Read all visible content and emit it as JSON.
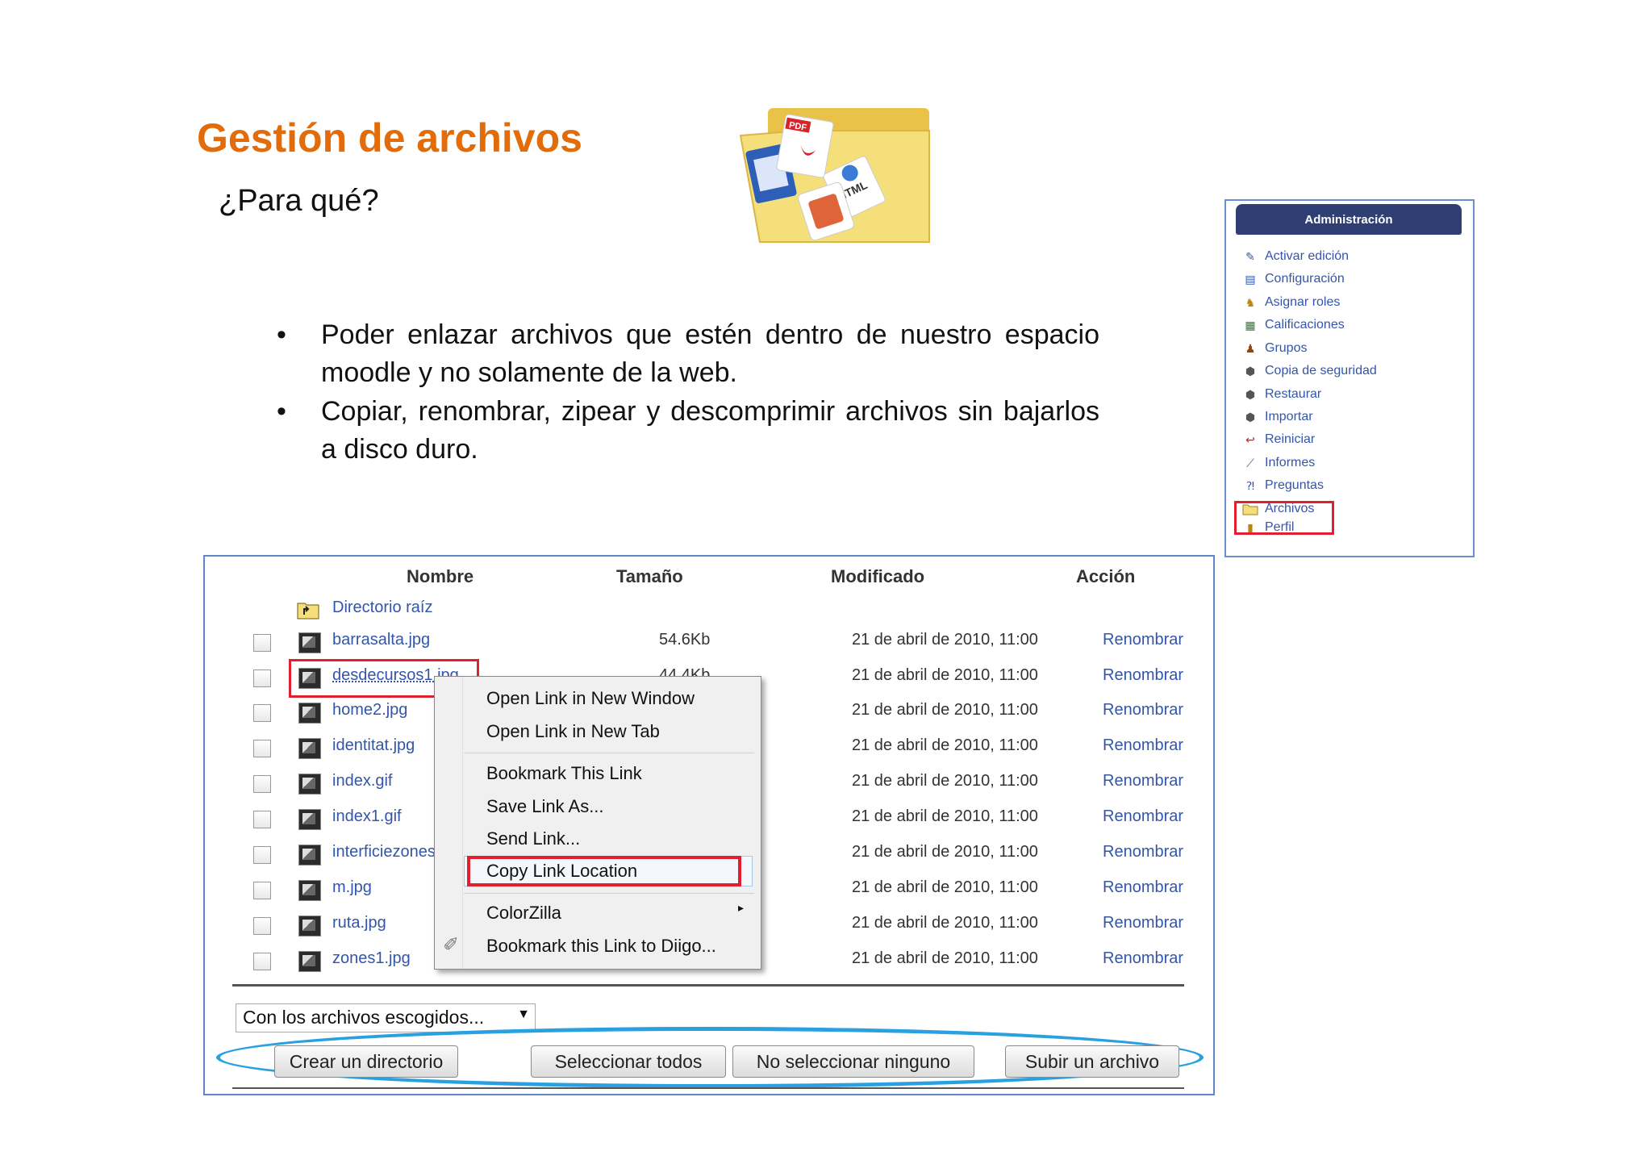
{
  "slide": {
    "title": "Gestión de archivos",
    "subtitle": "¿Para qué?",
    "bullets": [
      {
        "marker": "•",
        "text": "Poder enlazar archivos que estén dentro de nuestro espacio moodle y no solamente de la web."
      },
      {
        "marker": "•",
        "text": "Copiar, renombrar, zipear y descomprimir archivos sin bajarlos a disco duro."
      }
    ]
  },
  "folder_graphic": {
    "labels": [
      "PDF",
      "HTML"
    ]
  },
  "admin": {
    "header": "Administración",
    "items": [
      {
        "label": "Activar edición",
        "icon": "pencil-icon"
      },
      {
        "label": "Configuración",
        "icon": "settings-icon"
      },
      {
        "label": "Asignar roles",
        "icon": "roles-icon"
      },
      {
        "label": "Calificaciones",
        "icon": "grades-icon"
      },
      {
        "label": "Grupos",
        "icon": "groups-icon"
      },
      {
        "label": "Copia de seguridad",
        "icon": "backup-icon"
      },
      {
        "label": "Restaurar",
        "icon": "restore-icon"
      },
      {
        "label": "Importar",
        "icon": "import-icon"
      },
      {
        "label": "Reiniciar",
        "icon": "reset-icon"
      },
      {
        "label": "Informes",
        "icon": "reports-icon"
      },
      {
        "label": "Preguntas",
        "icon": "questions-icon"
      },
      {
        "label": "Archivos",
        "icon": "folder-icon"
      },
      {
        "label": "Perfil",
        "icon": "profile-icon"
      }
    ]
  },
  "files": {
    "columns": [
      "Nombre",
      "Tamaño",
      "Modificado",
      "Acción"
    ],
    "root_dir": "Directorio raíz",
    "rows": [
      {
        "name": "barrasalta.jpg",
        "size": "54.6Kb",
        "modified": "21 de abril de 2010, 11:00",
        "action": "Renombrar"
      },
      {
        "name": "desdecursos1.jpg",
        "size": "44.4Kb",
        "modified": "21 de abril de 2010, 11:00",
        "action": "Renombrar"
      },
      {
        "name": "home2.jpg",
        "size": "",
        "modified": "21 de abril de 2010, 11:00",
        "action": "Renombrar"
      },
      {
        "name": "identitat.jpg",
        "size": "",
        "modified": "21 de abril de 2010, 11:00",
        "action": "Renombrar"
      },
      {
        "name": "index.gif",
        "size": "",
        "modified": "21 de abril de 2010, 11:00",
        "action": "Renombrar"
      },
      {
        "name": "index1.gif",
        "size": "",
        "modified": "21 de abril de 2010, 11:00",
        "action": "Renombrar"
      },
      {
        "name": "interficiezones",
        "size": "",
        "modified": "21 de abril de 2010, 11:00",
        "action": "Renombrar"
      },
      {
        "name": "m.jpg",
        "size": "",
        "modified": "21 de abril de 2010, 11:00",
        "action": "Renombrar"
      },
      {
        "name": "ruta.jpg",
        "size": "",
        "modified": "21 de abril de 2010, 11:00",
        "action": "Renombrar"
      },
      {
        "name": "zones1.jpg",
        "size": "",
        "modified": "21 de abril de 2010, 11:00",
        "action": "Renombrar"
      }
    ],
    "selected_action": "Con los archivos escogidos...",
    "buttons": {
      "create_dir": "Crear un directorio",
      "select_all": "Seleccionar todos",
      "select_none": "No seleccionar ninguno",
      "upload": "Subir un archivo"
    }
  },
  "context_menu": {
    "items": [
      "Open Link in New Window",
      "Open Link in New Tab",
      "Bookmark This Link",
      "Save Link As...",
      "Send Link...",
      "Copy Link Location",
      "ColorZilla",
      "Bookmark this Link to Diigo..."
    ],
    "submenu_arrow": "▸"
  }
}
